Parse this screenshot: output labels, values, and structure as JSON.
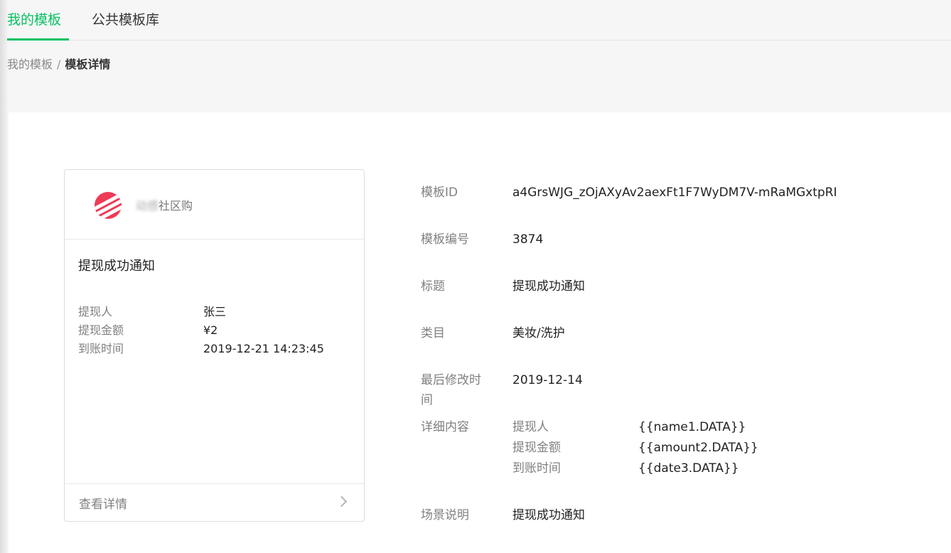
{
  "tabs": [
    {
      "label": "我的模板",
      "active": true
    },
    {
      "label": "公共模板库",
      "active": false
    }
  ],
  "breadcrumb": {
    "parent": "我的模板",
    "separator": "/",
    "current": "模板详情"
  },
  "preview": {
    "shop_name_blurred": "动感",
    "shop_name_visible": "社区购",
    "title": "提现成功通知",
    "fields": [
      {
        "key": "提现人",
        "value": "张三"
      },
      {
        "key": "提现金额",
        "value": "¥2"
      },
      {
        "key": "到账时间",
        "value": "2019-12-21 14:23:45"
      }
    ],
    "footer_label": "查看详情"
  },
  "details": {
    "template_id_label": "模板ID",
    "template_id": "a4GrsWJG_zOjAXyAv2aexFt1F7WyDM7V-mRaMGxtpRI",
    "template_no_label": "模板编号",
    "template_no": "3874",
    "title_label": "标题",
    "title": "提现成功通知",
    "category_label": "类目",
    "category": "美妆/洗护",
    "modified_label_line1": "最后修改时",
    "modified_label_line2": "间",
    "modified": "2019-12-14",
    "content_label": "详细内容",
    "content": [
      {
        "key": "提现人",
        "value": "{{name1.DATA}}"
      },
      {
        "key": "提现金额",
        "value": "{{amount2.DATA}}"
      },
      {
        "key": "到账时间",
        "value": "{{date3.DATA}}"
      }
    ],
    "scene_label": "场景说明",
    "scene": "提现成功通知"
  },
  "colors": {
    "accent": "#07c160",
    "logo": "#ef3a56"
  }
}
